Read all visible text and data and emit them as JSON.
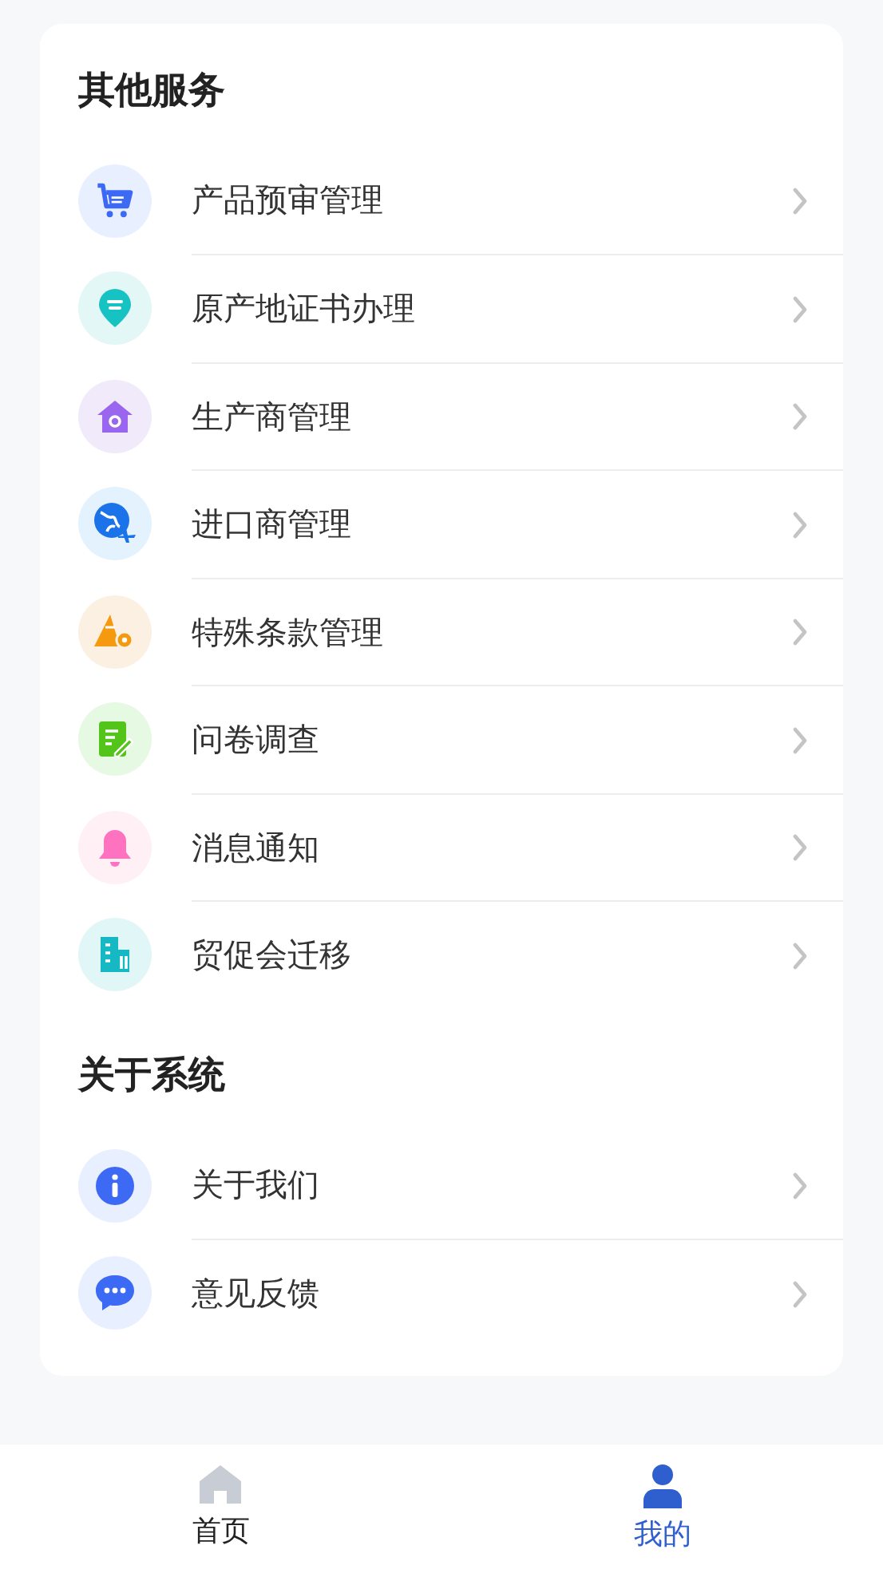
{
  "sections": [
    {
      "title": "其他服务",
      "items": [
        {
          "kind": "cart",
          "label": "产品预审管理"
        },
        {
          "kind": "pin",
          "label": "原产地证书办理"
        },
        {
          "kind": "house",
          "label": "生产商管理"
        },
        {
          "kind": "globe",
          "label": "进口商管理"
        },
        {
          "kind": "terms",
          "label": "特殊条款管理"
        },
        {
          "kind": "survey",
          "label": "问卷调查"
        },
        {
          "kind": "bell",
          "label": "消息通知"
        },
        {
          "kind": "building",
          "label": "贸促会迁移"
        }
      ]
    },
    {
      "title": "关于系统",
      "items": [
        {
          "kind": "info",
          "label": "关于我们"
        },
        {
          "kind": "chat",
          "label": "意见反馈"
        }
      ]
    }
  ],
  "tab_bar": [
    {
      "kind": "home",
      "label": "首页",
      "selected": false
    },
    {
      "kind": "person",
      "label": "我的",
      "selected": true
    }
  ]
}
